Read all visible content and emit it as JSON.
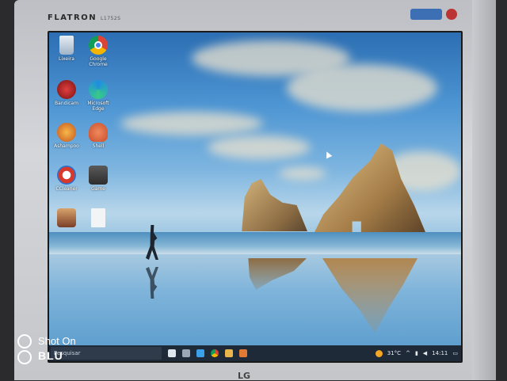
{
  "monitor": {
    "brand": "FLATRON",
    "model": "L1752S",
    "maker_logo": "LG"
  },
  "desktop": {
    "wallpaper": "beach-rocks-runner",
    "icons": [
      {
        "label": "Lixeira",
        "icon": "recycle-bin-icon"
      },
      {
        "label": "Google Chrome",
        "icon": "chrome-icon"
      },
      {
        "label": "Bandicam",
        "icon": "app-red-icon"
      },
      {
        "label": "Microsoft Edge",
        "icon": "edge-icon"
      },
      {
        "label": "Ashampoo",
        "icon": "app-orange-icon"
      },
      {
        "label": "Shell",
        "icon": "shell-icon"
      },
      {
        "label": "CCleaner",
        "icon": "ccleaner-icon"
      },
      {
        "label": "Game",
        "icon": "app-icon"
      },
      {
        "label": "",
        "icon": "photo-icon"
      },
      {
        "label": "",
        "icon": "file-icon"
      }
    ]
  },
  "taskbar": {
    "search_placeholder": "Pesquisar",
    "temperature": "31°C",
    "time": "14:11"
  },
  "watermark": {
    "line1": "Shot On",
    "line2": "BLU"
  },
  "colors": {
    "taskbar": "#1f2a38",
    "sky": "#4d95d3"
  }
}
